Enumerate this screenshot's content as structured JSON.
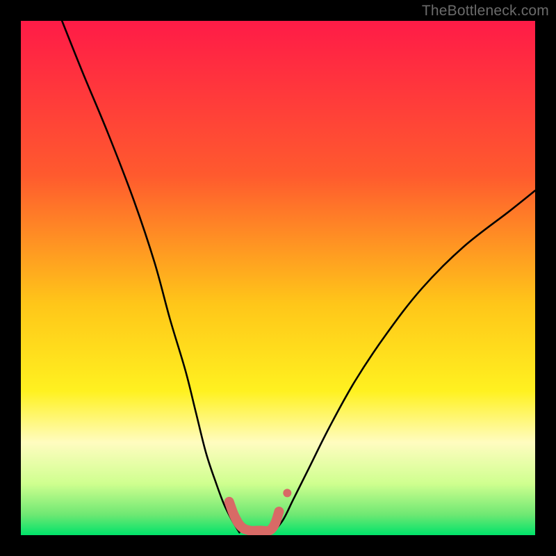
{
  "watermark": "TheBottleneck.com",
  "chart_data": {
    "type": "line",
    "title": "",
    "xlabel": "",
    "ylabel": "",
    "xlim": [
      0,
      100
    ],
    "ylim": [
      0,
      100
    ],
    "grid": false,
    "legend": false,
    "background_gradient": {
      "stops": [
        {
          "offset": 0.0,
          "color": "#ff1b47"
        },
        {
          "offset": 0.3,
          "color": "#ff5a2e"
        },
        {
          "offset": 0.55,
          "color": "#ffc619"
        },
        {
          "offset": 0.72,
          "color": "#fff120"
        },
        {
          "offset": 0.82,
          "color": "#fffcc0"
        },
        {
          "offset": 0.9,
          "color": "#cfff8f"
        },
        {
          "offset": 0.96,
          "color": "#6fe873"
        },
        {
          "offset": 1.0,
          "color": "#00e36a"
        }
      ]
    },
    "series": [
      {
        "name": "curve-left",
        "x": [
          8,
          12,
          17,
          22,
          26,
          29,
          32,
          34,
          36,
          38,
          39.5,
          41,
          42.5
        ],
        "y": [
          100,
          90,
          78,
          65,
          53,
          42,
          32,
          24,
          16,
          10,
          6,
          3,
          0.5
        ],
        "stroke": "#000000",
        "width": 2.6
      },
      {
        "name": "curve-right",
        "x": [
          49,
          51,
          53,
          56,
          60,
          65,
          71,
          78,
          86,
          95,
          100
        ],
        "y": [
          0.5,
          3,
          7,
          13,
          21,
          30,
          39,
          48,
          56,
          63,
          67
        ],
        "stroke": "#000000",
        "width": 2.6
      },
      {
        "name": "bottom-highlight",
        "points": [
          {
            "x": 40.5,
            "y": 6.5
          },
          {
            "x": 41.5,
            "y": 3.8
          },
          {
            "x": 42.8,
            "y": 1.7
          },
          {
            "x": 44.5,
            "y": 0.9
          },
          {
            "x": 46.5,
            "y": 0.9
          },
          {
            "x": 48.3,
            "y": 0.9
          },
          {
            "x": 49.4,
            "y": 2.2
          },
          {
            "x": 50.2,
            "y": 4.6
          }
        ],
        "stroke": "#d86a66",
        "width": 14,
        "extra_dot": {
          "x": 51.8,
          "y": 8.2,
          "r": 6
        }
      }
    ]
  }
}
